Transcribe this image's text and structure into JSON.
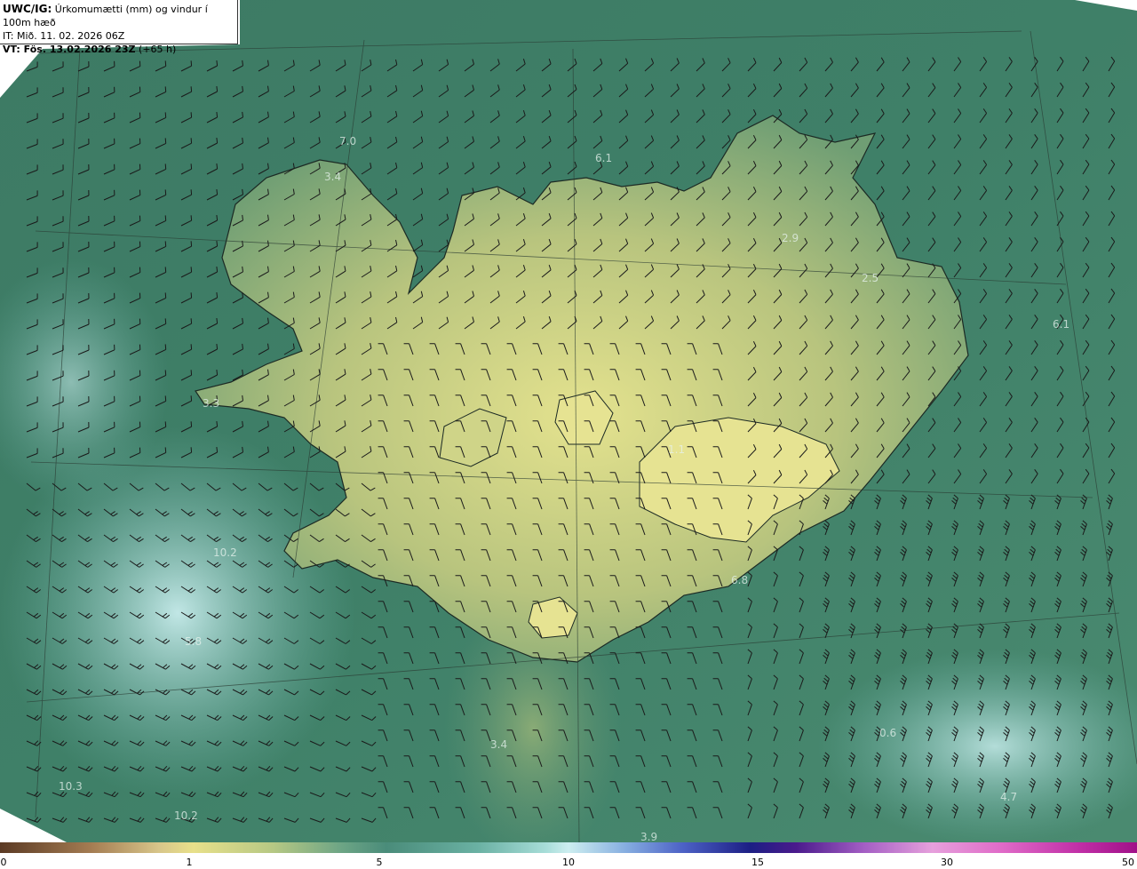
{
  "header": {
    "line1_bold": "UWC/IG:",
    "line1_text": " Úrkomumætti (mm) og vindur í 100m hæð",
    "line2": "IT: Mið. 11. 02. 2026 06Z",
    "line3_bold": "VT: Fös. 13.02.2026 23Z",
    "line3_text": " (+65 h)"
  },
  "map_labels": [
    {
      "id": "l1",
      "text": "7.0"
    },
    {
      "id": "l2",
      "text": "6.1"
    },
    {
      "id": "l3",
      "text": "3.4"
    },
    {
      "id": "l4",
      "text": "2.9"
    },
    {
      "id": "l5",
      "text": "2.5"
    },
    {
      "id": "l6",
      "text": "6.1"
    },
    {
      "id": "l7",
      "text": "3.3"
    },
    {
      "id": "l8",
      "text": "1.1"
    },
    {
      "id": "l9",
      "text": "10.2"
    },
    {
      "id": "l10",
      "text": "6.8"
    },
    {
      "id": "l11",
      "text": "5.8"
    },
    {
      "id": "l12",
      "text": "3.4"
    },
    {
      "id": "l13",
      "text": "10.3"
    },
    {
      "id": "l14",
      "text": "10.2"
    },
    {
      "id": "l15",
      "text": "3.9"
    },
    {
      "id": "l16",
      "text": "4.7"
    },
    {
      "id": "l17",
      "text": "0.6"
    }
  ],
  "legend": {
    "ticks": [
      "0",
      "1",
      "5",
      "10",
      "15",
      "30",
      "50"
    ]
  },
  "colors": {
    "sea_dark": "#3e7a62",
    "land_yellow": "#e2e08a",
    "land_green": "#7fa877",
    "heavy_cyan": "#b8e6e6"
  }
}
